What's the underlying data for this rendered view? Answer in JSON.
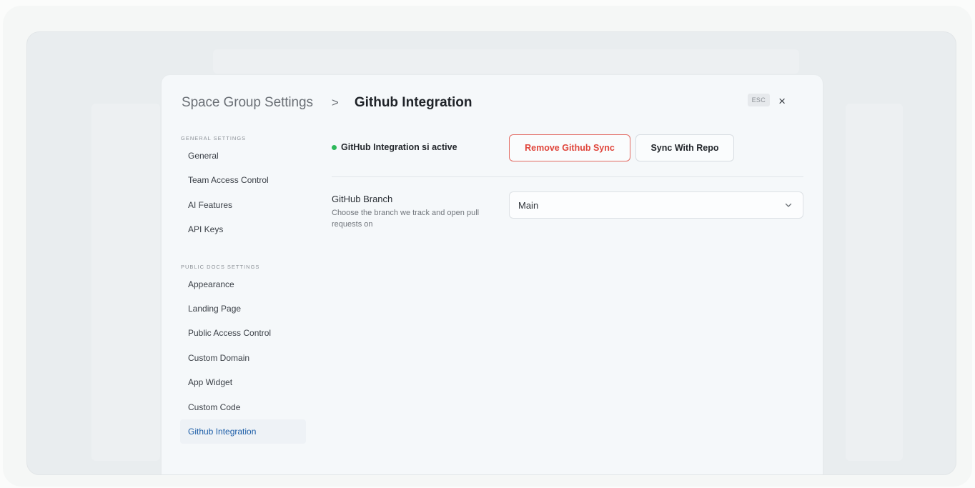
{
  "breadcrumb": {
    "root": "Space Group Settings",
    "separator": ">",
    "current": "Github Integration"
  },
  "esc_label": "ESC",
  "close_icon": "×",
  "sidebar": {
    "sections": [
      {
        "label": "GENERAL SETTINGS",
        "items": [
          "General",
          "Team Access Control",
          "AI Features",
          "API Keys"
        ]
      },
      {
        "label": "PUBLIC DOCS SETTINGS",
        "items": [
          "Appearance",
          "Landing Page",
          "Public Access Control",
          "Custom Domain",
          "App Widget",
          "Custom Code",
          "Github Integration"
        ]
      }
    ],
    "active_item": "Github Integration"
  },
  "main": {
    "status_text": "GitHub Integration si active",
    "remove_button": "Remove Github Sync",
    "sync_button": "Sync With Repo",
    "branch_title": "GitHub Branch",
    "branch_description": "Choose the branch we track and open pull requests on",
    "branch_value": "Main"
  },
  "colors": {
    "status_dot": "#2db85a",
    "remove_accent": "#e0463c",
    "active_nav": "#1d5ea8"
  }
}
